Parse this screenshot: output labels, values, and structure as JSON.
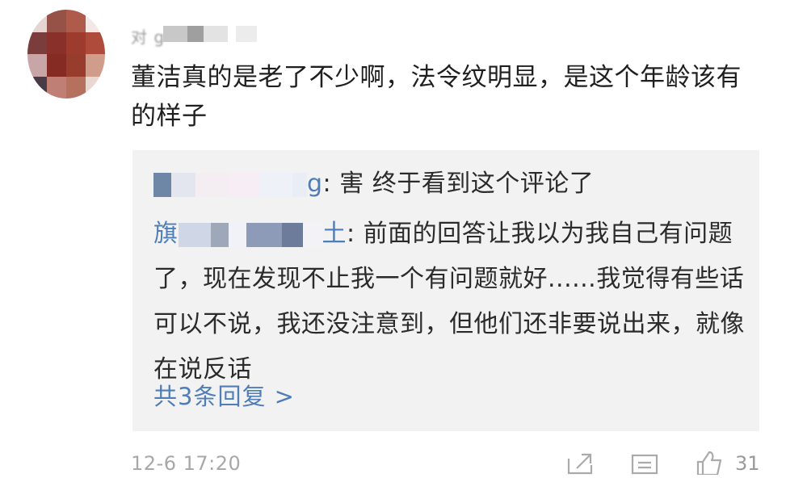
{
  "comment": {
    "username": "对              g",
    "text": "董洁真的是老了不少啊，法令纹明显，是这个年龄该有的样子"
  },
  "replies": [
    {
      "author_visible_suffix": "g",
      "text": ": 害  终于看到这个评论了"
    },
    {
      "author_visible_prefix": "旗",
      "author_visible_suffix": "土",
      "text": ": 前面的回答让我以为我自己有问题了，现在发现不止我一个有问题就好......我觉得有些话可以不说，我还没注意到，但他们还非要说出来，就像在说反话"
    }
  ],
  "more_replies_label": "共3条回复 >",
  "footer": {
    "timestamp": "12-6 17:20",
    "like_count": "31",
    "icons": [
      "share-icon",
      "comment-icon",
      "like-icon"
    ]
  },
  "colors": {
    "link": "#4f7db8",
    "reply_background": "#f2f2f2",
    "meta_text": "#a8a8a8"
  }
}
